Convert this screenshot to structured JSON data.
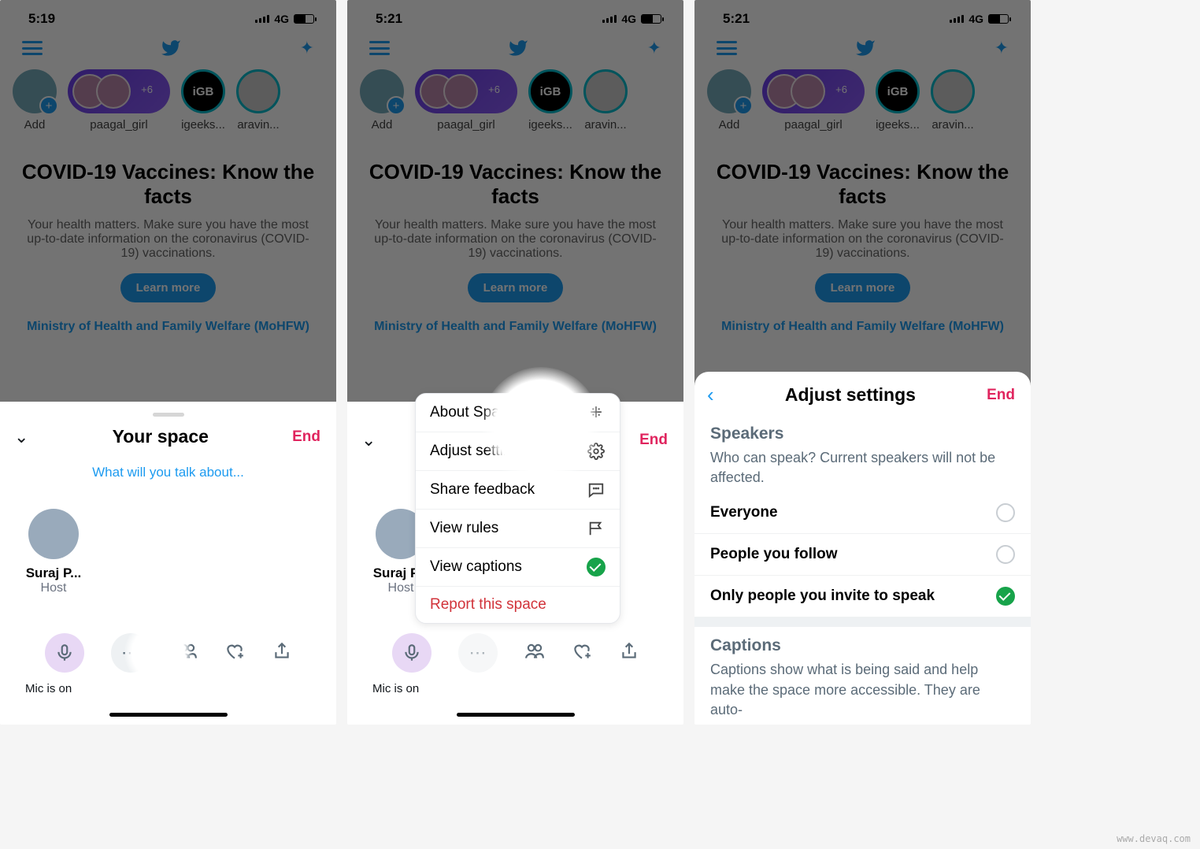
{
  "status": {
    "time1": "5:19",
    "time2": "5:21",
    "time3": "5:21",
    "net": "4G"
  },
  "stories": {
    "add": "Add",
    "paagal": "paagal_girl",
    "igeeks": "igeeks...",
    "aravin": "aravin...",
    "igb": "iGB",
    "plus": "+6"
  },
  "covid": {
    "title": "COVID-19 Vaccines: Know the facts",
    "desc": "Your health matters. Make sure you have the most up-to-date information on the coronavirus (COVID-19) vaccinations.",
    "button": "Learn more",
    "source": "Ministry of Health and Family Welfare (MoHFW)"
  },
  "sheet": {
    "title": "Your space",
    "end": "End",
    "prompt": "What will you talk about...",
    "host_name": "Suraj P...",
    "host_role": "Host",
    "mic_label": "Mic is on"
  },
  "menu": {
    "about": "About Spaces",
    "adjust": "Adjust settings",
    "feedback": "Share feedback",
    "rules": "View rules",
    "captions": "View captions",
    "report": "Report this space"
  },
  "settings": {
    "title": "Adjust settings",
    "end": "End",
    "speakers_title": "Speakers",
    "speakers_desc": "Who can speak? Current speakers will not be affected.",
    "opt_everyone": "Everyone",
    "opt_follow": "People you follow",
    "opt_invite": "Only people you invite to speak",
    "captions_title": "Captions",
    "captions_desc": "Captions show what is being said and help make the space more accessible. They are auto-"
  },
  "watermark": "www.devaq.com"
}
